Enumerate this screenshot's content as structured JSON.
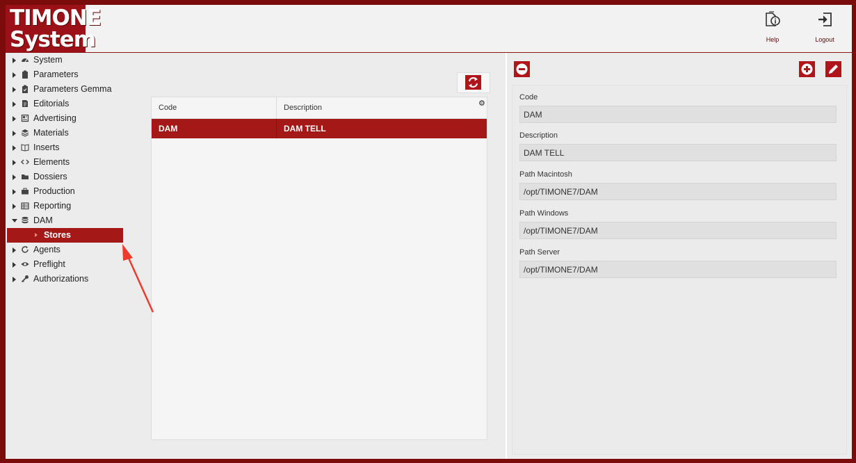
{
  "app": {
    "logo_line1": "TIMONE",
    "logo_line2": "System"
  },
  "header": {
    "help_label": "Help",
    "logout_label": "Logout"
  },
  "sidebar": {
    "items": [
      {
        "label": "System",
        "icon": "dashboard-icon"
      },
      {
        "label": "Parameters",
        "icon": "clipboard-icon"
      },
      {
        "label": "Parameters Gemma",
        "icon": "clipboard-check-icon"
      },
      {
        "label": "Editorials",
        "icon": "document-icon"
      },
      {
        "label": "Advertising",
        "icon": "newspaper-icon"
      },
      {
        "label": "Materials",
        "icon": "layers-icon"
      },
      {
        "label": "Inserts",
        "icon": "book-icon"
      },
      {
        "label": "Elements",
        "icon": "code-icon"
      },
      {
        "label": "Dossiers",
        "icon": "folder-icon"
      },
      {
        "label": "Production",
        "icon": "briefcase-icon"
      },
      {
        "label": "Reporting",
        "icon": "table-icon"
      },
      {
        "label": "DAM",
        "icon": "database-icon"
      },
      {
        "label": "Agents",
        "icon": "refresh-icon"
      },
      {
        "label": "Preflight",
        "icon": "eye-icon"
      },
      {
        "label": "Authorizations",
        "icon": "key-icon"
      }
    ],
    "selected_sub": "Stores"
  },
  "grid": {
    "columns": [
      "Code",
      "Description"
    ],
    "rows": [
      {
        "code": "DAM",
        "description": "DAM TELL"
      }
    ]
  },
  "detail": {
    "fields": [
      {
        "label": "Code",
        "value": "DAM"
      },
      {
        "label": "Description",
        "value": "DAM TELL"
      },
      {
        "label": "Path Macintosh",
        "value": "/opt/TIMONE7/DAM"
      },
      {
        "label": "Path Windows",
        "value": "/opt/TIMONE7/DAM"
      },
      {
        "label": "Path Server",
        "value": "/opt/TIMONE7/DAM"
      }
    ]
  },
  "colors": {
    "accent": "#a51818",
    "frame": "#7a0c0c"
  }
}
